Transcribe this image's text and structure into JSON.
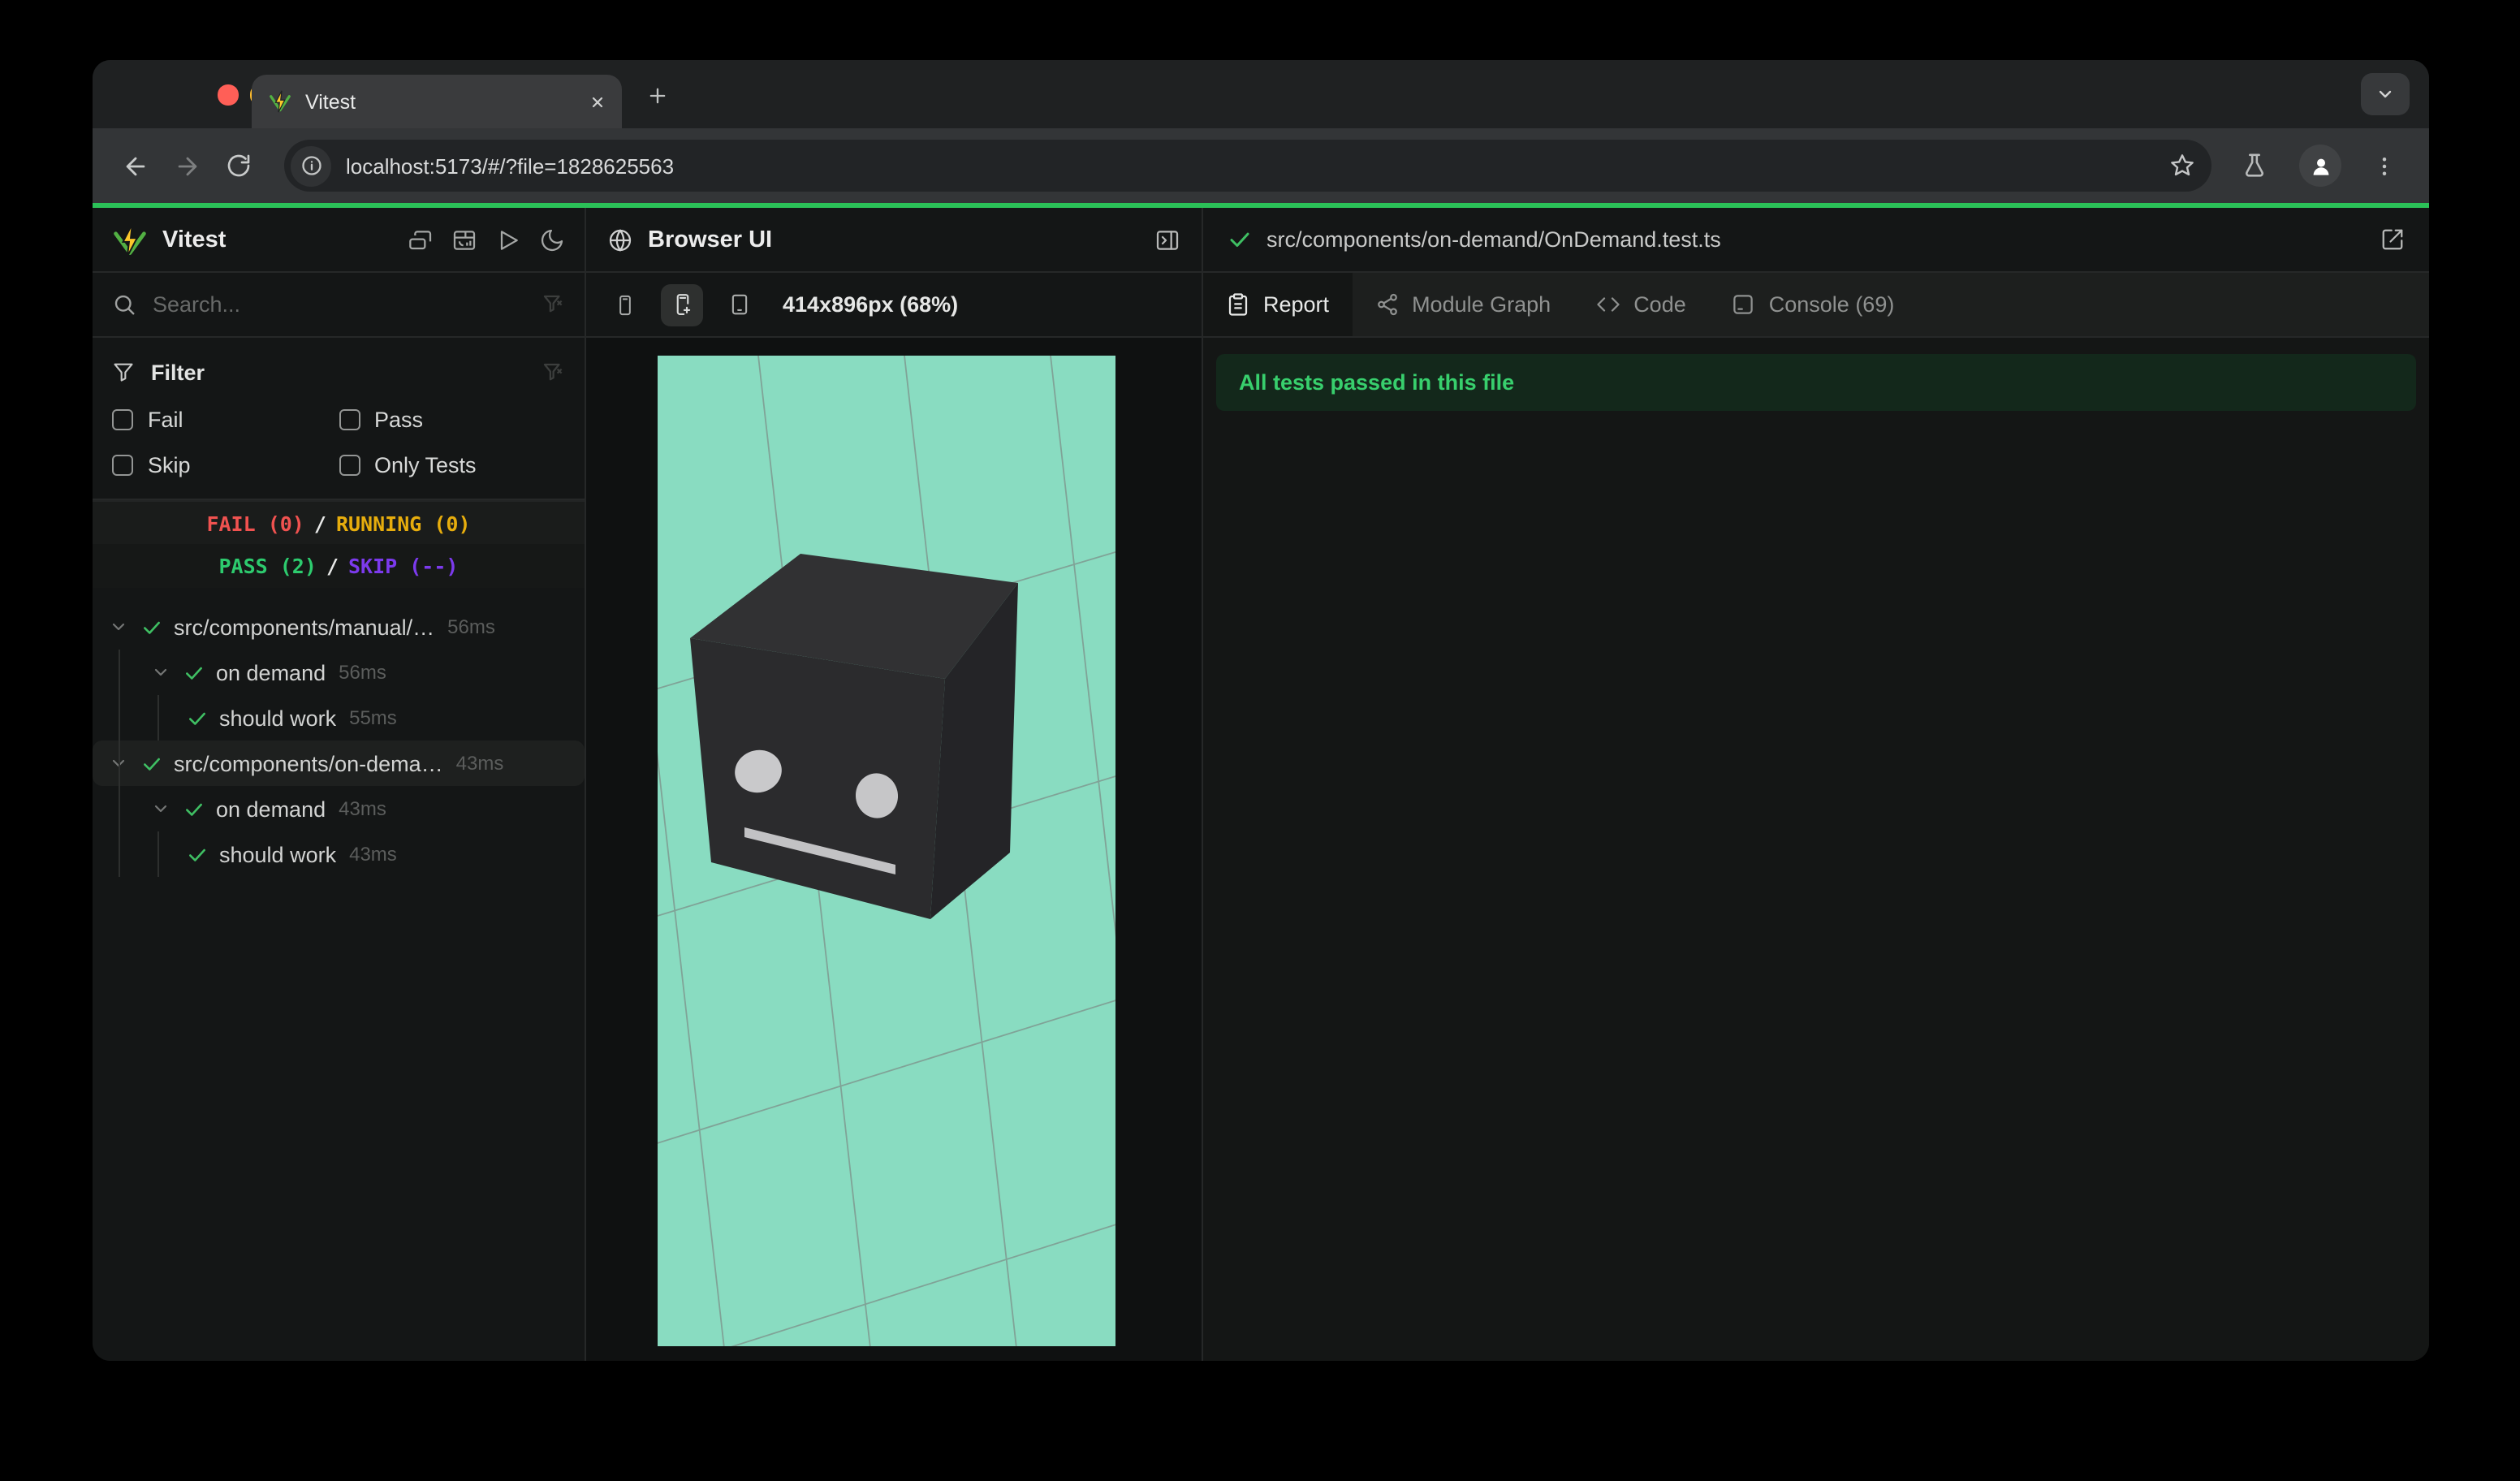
{
  "colors": {
    "accent-green": "#2bc158",
    "check-green": "#3fbf63",
    "fail-red": "#f05250",
    "running-yellow": "#e7ad0d",
    "pass-green": "#2dcb6e",
    "skip-purple": "#7c3aed",
    "banner-bg": "#13281b",
    "banner-text": "#38cf6d",
    "teal": "#89dcc1"
  },
  "browser": {
    "tab_title": "Vitest",
    "url": "localhost:5173/#/?file=1828625563"
  },
  "sidebar": {
    "app_title": "Vitest",
    "search_placeholder": "Search...",
    "filter": {
      "title": "Filter",
      "options": [
        {
          "label": "Fail"
        },
        {
          "label": "Pass"
        },
        {
          "label": "Skip"
        },
        {
          "label": "Only Tests"
        }
      ]
    },
    "summary": {
      "fail": "FAIL (0)",
      "running": "RUNNING (0)",
      "pass": "PASS (2)",
      "skip": "SKIP (--)",
      "sep": "/"
    },
    "tree": [
      {
        "label": "src/components/manual/…",
        "duration": "56ms"
      },
      {
        "label": "on demand",
        "duration": "56ms"
      },
      {
        "label": "should work",
        "duration": "55ms"
      },
      {
        "label": "src/components/on-dema…",
        "duration": "43ms"
      },
      {
        "label": "on demand",
        "duration": "43ms"
      },
      {
        "label": "should work",
        "duration": "43ms"
      }
    ]
  },
  "browser_panel": {
    "title": "Browser UI",
    "viewport_label": "414x896px (68%)"
  },
  "report_panel": {
    "file_path": "src/components/on-demand/OnDemand.test.ts",
    "tabs": [
      {
        "label": "Report"
      },
      {
        "label": "Module Graph"
      },
      {
        "label": "Code"
      },
      {
        "label": "Console (69)"
      }
    ],
    "banner": "All tests passed in this file"
  }
}
